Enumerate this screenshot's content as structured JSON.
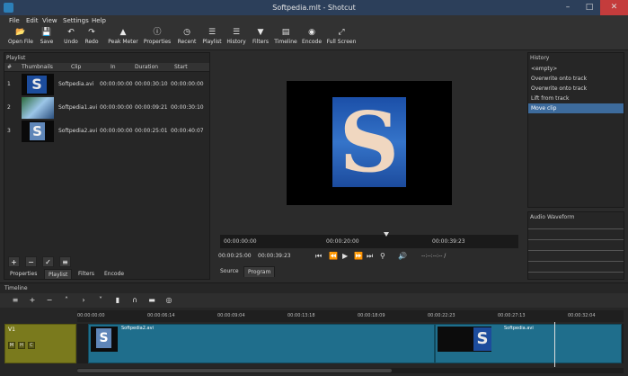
{
  "window": {
    "title": "Softpedia.mlt - Shotcut"
  },
  "menu": [
    "File",
    "Edit",
    "View",
    "Settings",
    "Help"
  ],
  "toolbar": [
    {
      "label": "Open File",
      "icon": "folder-icon"
    },
    {
      "label": "Save",
      "icon": "save-icon"
    },
    {
      "label": "Undo",
      "icon": "undo-icon"
    },
    {
      "label": "Redo",
      "icon": "redo-icon"
    },
    {
      "label": "Peak Meter",
      "icon": "peak-meter-icon"
    },
    {
      "label": "Properties",
      "icon": "properties-icon"
    },
    {
      "label": "Recent",
      "icon": "recent-icon"
    },
    {
      "label": "Playlist",
      "icon": "playlist-icon"
    },
    {
      "label": "History",
      "icon": "history-icon"
    },
    {
      "label": "Filters",
      "icon": "filters-icon"
    },
    {
      "label": "Timeline",
      "icon": "timeline-icon"
    },
    {
      "label": "Encode",
      "icon": "encode-icon"
    },
    {
      "label": "Full Screen",
      "icon": "fullscreen-icon"
    }
  ],
  "playlist": {
    "title": "Playlist",
    "columns": [
      "#",
      "Thumbnails",
      "Clip",
      "In",
      "Duration",
      "Start"
    ],
    "rows": [
      {
        "num": "1",
        "clip": "Softpedia.avi",
        "in": "00:00:00:00",
        "duration": "00:00:30:10",
        "start": "00:00:00:00"
      },
      {
        "num": "2",
        "clip": "Softpedia1.avi",
        "in": "00:00:00:00",
        "duration": "00:00:09:21",
        "start": "00:00:30:10"
      },
      {
        "num": "3",
        "clip": "Softpedia2.avi",
        "in": "00:00:00:00",
        "duration": "00:00:25:01",
        "start": "00:00:40:07"
      }
    ],
    "tabs": [
      "Properties",
      "Playlist",
      "Filters",
      "Encode"
    ]
  },
  "viewer": {
    "ruler_ticks": [
      "00:00:00:00",
      "00:00:20:00",
      "00:00:39:23"
    ],
    "current_time": "00:00:25:00",
    "duration": "00:00:39:23",
    "in_out": "--:--:--:-- /",
    "tabs": [
      "Source",
      "Program"
    ]
  },
  "history": {
    "title": "History",
    "items": [
      "<empty>",
      "Overwrite onto track",
      "Overwrite onto track",
      "Lift from track",
      "Move clip"
    ]
  },
  "waveform": {
    "title": "Audio Waveform"
  },
  "timeline": {
    "title": "Timeline",
    "ruler_ticks": [
      "00:00:00:00",
      "00:00:06:14",
      "00:00:09:04",
      "00:00:13:18",
      "00:00:18:09",
      "00:00:22:23",
      "00:00:27:13",
      "00:00:32:04"
    ],
    "track_name": "V1",
    "clips": [
      "Softpedia2.avi",
      "Softpedia.avi"
    ]
  }
}
